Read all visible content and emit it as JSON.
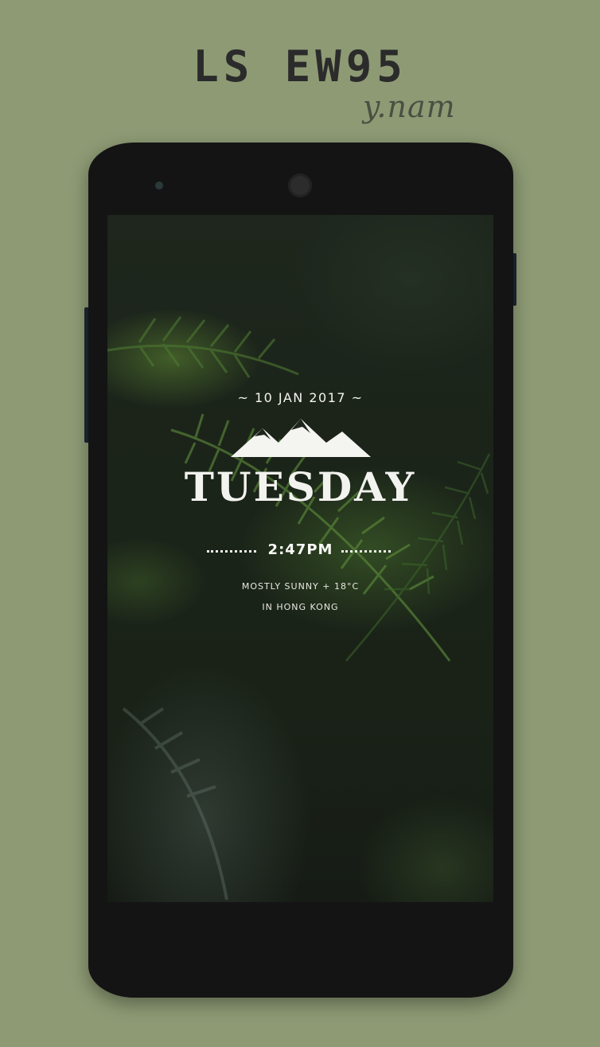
{
  "header": {
    "title": "LS EW95",
    "signature": "y.nam"
  },
  "lockscreen": {
    "date": "~ 10 JAN 2017 ~",
    "day": "TUESDAY",
    "time": "2:47PM",
    "weather": "MOSTLY SUNNY + 18°C",
    "location": "IN HONG KONG"
  },
  "colors": {
    "background": "#8d9a74",
    "phone_body": "#141414",
    "widget_text": "#f2f2ee"
  },
  "icons": [
    "mountains-icon",
    "camera-icon",
    "sensor-icon"
  ]
}
